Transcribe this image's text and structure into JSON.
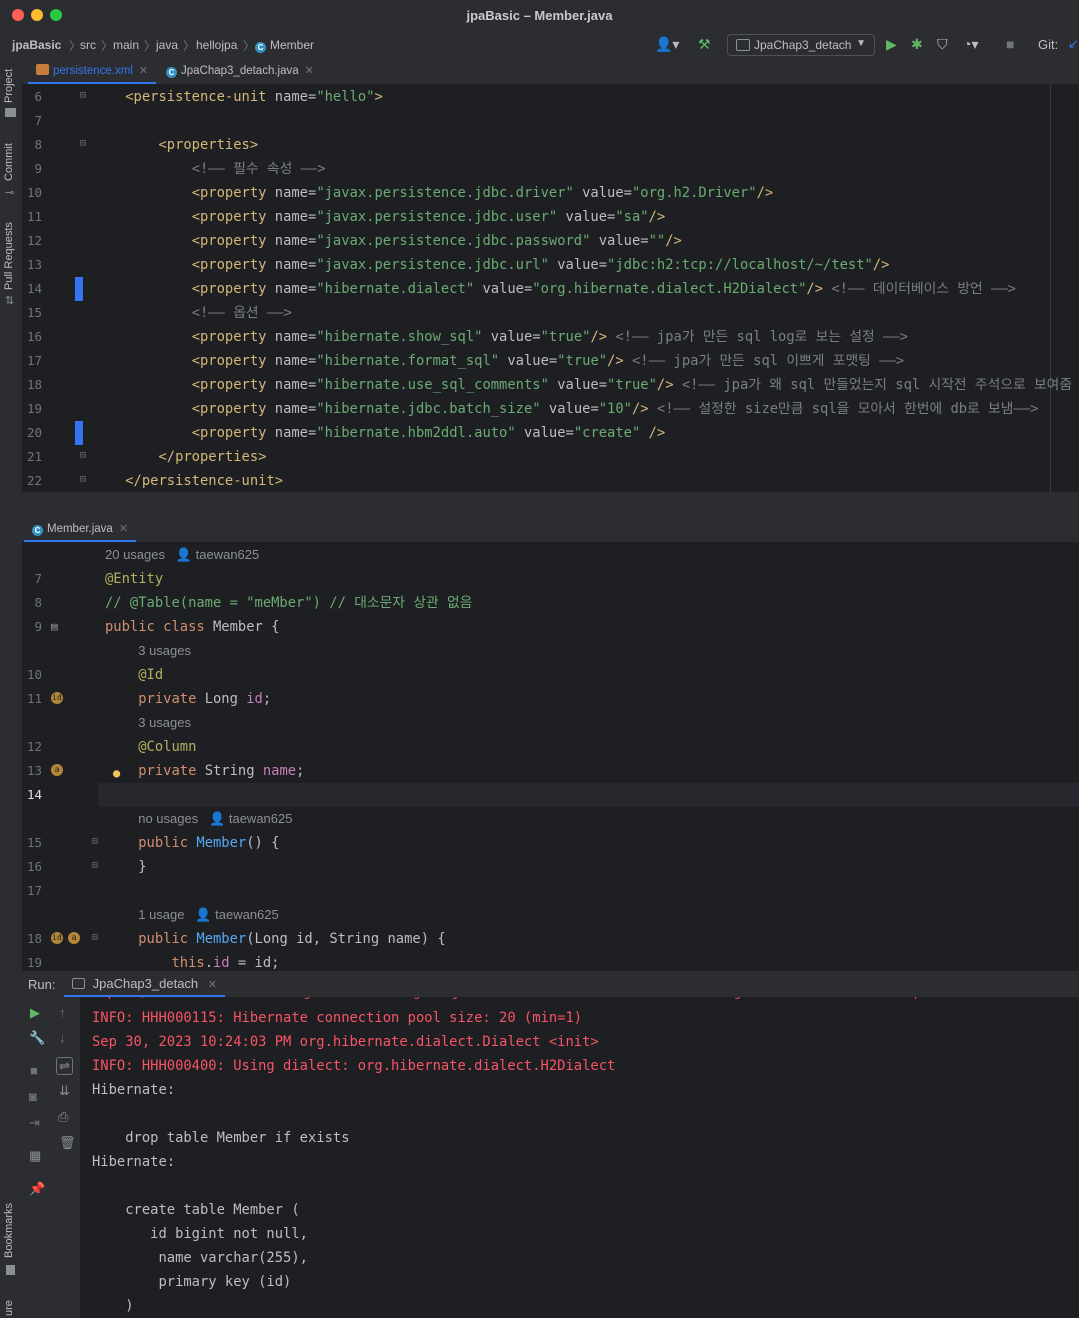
{
  "window": {
    "title": "jpaBasic – Member.java",
    "lights": [
      "#ff5f57",
      "#febc2e",
      "#28c840"
    ]
  },
  "breadcrumb": [
    "jpaBasic",
    "src",
    "main",
    "java",
    "hellojpa",
    "Member"
  ],
  "toolbar": {
    "run_config": "JpaChap3_detach",
    "git_label": "Git:"
  },
  "left_tools": [
    "Project",
    "Commit",
    "Pull Requests",
    "Bookmarks",
    "ure"
  ],
  "top_editor": {
    "tabs": [
      {
        "label": "persistence.xml",
        "active": true
      },
      {
        "label": "JpaChap3_detach.java",
        "active": false
      }
    ],
    "lines": [
      {
        "n": "6",
        "parts": [
          [
            "p",
            "    "
          ],
          [
            "t",
            "<persistence-unit "
          ],
          [
            "a",
            "name="
          ],
          [
            "s",
            "\"hello\""
          ],
          [
            "t",
            ">"
          ]
        ]
      },
      {
        "n": "7",
        "parts": []
      },
      {
        "n": "8",
        "parts": [
          [
            "p",
            "        "
          ],
          [
            "t",
            "<properties>"
          ]
        ]
      },
      {
        "n": "9",
        "parts": [
          [
            "p",
            "            "
          ],
          [
            "c",
            "<!—— 필수 속성 ——>"
          ]
        ]
      },
      {
        "n": "10",
        "parts": [
          [
            "p",
            "            "
          ],
          [
            "t",
            "<property "
          ],
          [
            "a",
            "name="
          ],
          [
            "s",
            "\"javax.persistence.jdbc.driver\" "
          ],
          [
            "a",
            "value="
          ],
          [
            "s",
            "\"org.h2.Driver\""
          ],
          [
            "t",
            "/>"
          ]
        ]
      },
      {
        "n": "11",
        "parts": [
          [
            "p",
            "            "
          ],
          [
            "t",
            "<property "
          ],
          [
            "a",
            "name="
          ],
          [
            "s",
            "\"javax.persistence.jdbc.user\" "
          ],
          [
            "a",
            "value="
          ],
          [
            "s",
            "\"sa\""
          ],
          [
            "t",
            "/>"
          ]
        ]
      },
      {
        "n": "12",
        "parts": [
          [
            "p",
            "            "
          ],
          [
            "t",
            "<property "
          ],
          [
            "a",
            "name="
          ],
          [
            "s",
            "\"javax.persistence.jdbc.password\" "
          ],
          [
            "a",
            "value="
          ],
          [
            "s",
            "\"\""
          ],
          [
            "t",
            "/>"
          ]
        ]
      },
      {
        "n": "13",
        "parts": [
          [
            "p",
            "            "
          ],
          [
            "t",
            "<property "
          ],
          [
            "a",
            "name="
          ],
          [
            "s",
            "\"javax.persistence.jdbc.url\" "
          ],
          [
            "a",
            "value="
          ],
          [
            "s",
            "\"jdbc:h2:tcp://localhost/~/test\""
          ],
          [
            "t",
            "/>"
          ]
        ]
      },
      {
        "n": "14",
        "parts": [
          [
            "p",
            "            "
          ],
          [
            "t",
            "<property "
          ],
          [
            "a",
            "name="
          ],
          [
            "s",
            "\"hibernate.dialect\" "
          ],
          [
            "a",
            "value="
          ],
          [
            "s",
            "\"org.hibernate.dialect.H2Dialect\""
          ],
          [
            "t",
            "/>"
          ],
          [
            "c",
            " <!—— 데이터베이스 방언 ——>"
          ]
        ]
      },
      {
        "n": "15",
        "parts": [
          [
            "p",
            "            "
          ],
          [
            "c",
            "<!—— 옵션 ——>"
          ]
        ]
      },
      {
        "n": "16",
        "parts": [
          [
            "p",
            "            "
          ],
          [
            "t",
            "<property "
          ],
          [
            "a",
            "name="
          ],
          [
            "s",
            "\"hibernate.show_sql\" "
          ],
          [
            "a",
            "value="
          ],
          [
            "s",
            "\"true\""
          ],
          [
            "t",
            "/>"
          ],
          [
            "c",
            " <!—— jpa가 만든 sql log로 보는 설정 ——>"
          ]
        ]
      },
      {
        "n": "17",
        "parts": [
          [
            "p",
            "            "
          ],
          [
            "t",
            "<property "
          ],
          [
            "a",
            "name="
          ],
          [
            "s",
            "\"hibernate.format_sql\" "
          ],
          [
            "a",
            "value="
          ],
          [
            "s",
            "\"true\""
          ],
          [
            "t",
            "/>"
          ],
          [
            "c",
            " <!—— jpa가 만든 sql 이쁘게 포맷팅 ——>"
          ]
        ]
      },
      {
        "n": "18",
        "parts": [
          [
            "p",
            "            "
          ],
          [
            "t",
            "<property "
          ],
          [
            "a",
            "name="
          ],
          [
            "s",
            "\"hibernate.use_sql_comments\" "
          ],
          [
            "a",
            "value="
          ],
          [
            "s",
            "\"true\""
          ],
          [
            "t",
            "/>"
          ],
          [
            "c",
            " <!—— jpa가 왜 sql 만들었는지 sql 시작전 주석으로 보여줌 ——>"
          ]
        ]
      },
      {
        "n": "19",
        "parts": [
          [
            "p",
            "            "
          ],
          [
            "t",
            "<property "
          ],
          [
            "a",
            "name="
          ],
          [
            "s",
            "\"hibernate.jdbc.batch_size\" "
          ],
          [
            "a",
            "value="
          ],
          [
            "s",
            "\"10\""
          ],
          [
            "t",
            "/>"
          ],
          [
            "c",
            " <!—— 설정한 size만큼 sql을 모아서 한번에 db로 보냄——>"
          ]
        ]
      },
      {
        "n": "20",
        "parts": [
          [
            "p",
            "            "
          ],
          [
            "t",
            "<property "
          ],
          [
            "a",
            "name="
          ],
          [
            "s",
            "\"hibernate.hbm2ddl.auto\" "
          ],
          [
            "a",
            "value="
          ],
          [
            "s",
            "\"create\""
          ],
          [
            "t",
            " />"
          ]
        ]
      },
      {
        "n": "21",
        "parts": [
          [
            "p",
            "        "
          ],
          [
            "t",
            "</properties>"
          ]
        ]
      },
      {
        "n": "22",
        "parts": [
          [
            "p",
            "    "
          ],
          [
            "t",
            "</persistence-unit>"
          ]
        ]
      }
    ]
  },
  "bottom_editor": {
    "tabs": [
      {
        "label": "Member.java",
        "active": true
      }
    ],
    "lines": [
      {
        "n": "",
        "hint": true,
        "parts": [
          [
            "h",
            "20 usages   👤 taewan625"
          ]
        ]
      },
      {
        "n": "7",
        "parts": [
          [
            "n",
            "@Entity"
          ]
        ]
      },
      {
        "n": "8",
        "parts": [
          [
            "g",
            "// @Table(name = \"meMber\") // 대소문자 상관 없음"
          ]
        ]
      },
      {
        "n": "9",
        "parts": [
          [
            "k",
            "public class "
          ],
          [
            "p",
            "Member {"
          ]
        ]
      },
      {
        "n": "",
        "hint": true,
        "parts": [
          [
            "p",
            "    "
          ],
          [
            "h",
            "3 usages"
          ]
        ]
      },
      {
        "n": "10",
        "parts": [
          [
            "p",
            "    "
          ],
          [
            "n",
            "@Id"
          ]
        ]
      },
      {
        "n": "11",
        "parts": [
          [
            "p",
            "    "
          ],
          [
            "k",
            "private "
          ],
          [
            "p",
            "Long "
          ],
          [
            "f",
            "id"
          ],
          [
            "p",
            ";"
          ]
        ]
      },
      {
        "n": "",
        "hint": true,
        "parts": [
          [
            "p",
            "    "
          ],
          [
            "h",
            "3 usages"
          ]
        ]
      },
      {
        "n": "12",
        "parts": [
          [
            "p",
            "    "
          ],
          [
            "n",
            "@Column"
          ]
        ]
      },
      {
        "n": "13",
        "parts": [
          [
            "p",
            "    "
          ],
          [
            "k",
            "private "
          ],
          [
            "p",
            "String "
          ],
          [
            "f",
            "name"
          ],
          [
            "p",
            ";"
          ]
        ]
      },
      {
        "n": "14",
        "parts": [],
        "current": true
      },
      {
        "n": "",
        "hint": true,
        "parts": [
          [
            "p",
            "    "
          ],
          [
            "h",
            "no usages   👤 taewan625"
          ]
        ]
      },
      {
        "n": "15",
        "parts": [
          [
            "p",
            "    "
          ],
          [
            "k",
            "public "
          ],
          [
            "m",
            "Member"
          ],
          [
            "p",
            "() {"
          ]
        ]
      },
      {
        "n": "16",
        "parts": [
          [
            "p",
            "    }"
          ]
        ]
      },
      {
        "n": "17",
        "parts": []
      },
      {
        "n": "",
        "hint": true,
        "parts": [
          [
            "p",
            "    "
          ],
          [
            "h",
            "1 usage   👤 taewan625"
          ]
        ]
      },
      {
        "n": "18",
        "parts": [
          [
            "p",
            "    "
          ],
          [
            "k",
            "public "
          ],
          [
            "m",
            "Member"
          ],
          [
            "p",
            "(Long "
          ],
          [
            "x",
            "id"
          ],
          [
            "p",
            ", String "
          ],
          [
            "x",
            "name"
          ],
          [
            "p",
            ") {"
          ]
        ]
      },
      {
        "n": "19",
        "parts": [
          [
            "p",
            "        "
          ],
          [
            "k",
            "this"
          ],
          [
            "p",
            "."
          ],
          [
            "f",
            "id"
          ],
          [
            "p",
            " = "
          ],
          [
            "x",
            "id"
          ],
          [
            "p",
            ";"
          ]
        ]
      }
    ]
  },
  "run": {
    "label": "Run:",
    "tab": "JpaChap3_detach",
    "console": [
      {
        "cls": "err",
        "text": "INFO: HHH000115: Hibernate connection pool size: 20 (min=1)"
      },
      {
        "cls": "err",
        "text": "Sep 30, 2023 10:24:03 PM org.hibernate.dialect.Dialect <init>"
      },
      {
        "cls": "err",
        "text": "INFO: HHH000400: Using dialect: org.hibernate.dialect.H2Dialect"
      },
      {
        "cls": "plain",
        "text": "Hibernate: "
      },
      {
        "cls": "plain",
        "text": ""
      },
      {
        "cls": "plain",
        "text": "    drop table Member if exists"
      },
      {
        "cls": "plain",
        "text": "Hibernate: "
      },
      {
        "cls": "plain",
        "text": ""
      },
      {
        "cls": "plain",
        "text": "    create table Member ("
      },
      {
        "cls": "plain",
        "text": "       id bigint not null,"
      },
      {
        "cls": "plain",
        "text": "        name varchar(255),"
      },
      {
        "cls": "plain",
        "text": "        primary key (id)"
      },
      {
        "cls": "plain",
        "text": "    )"
      }
    ]
  }
}
